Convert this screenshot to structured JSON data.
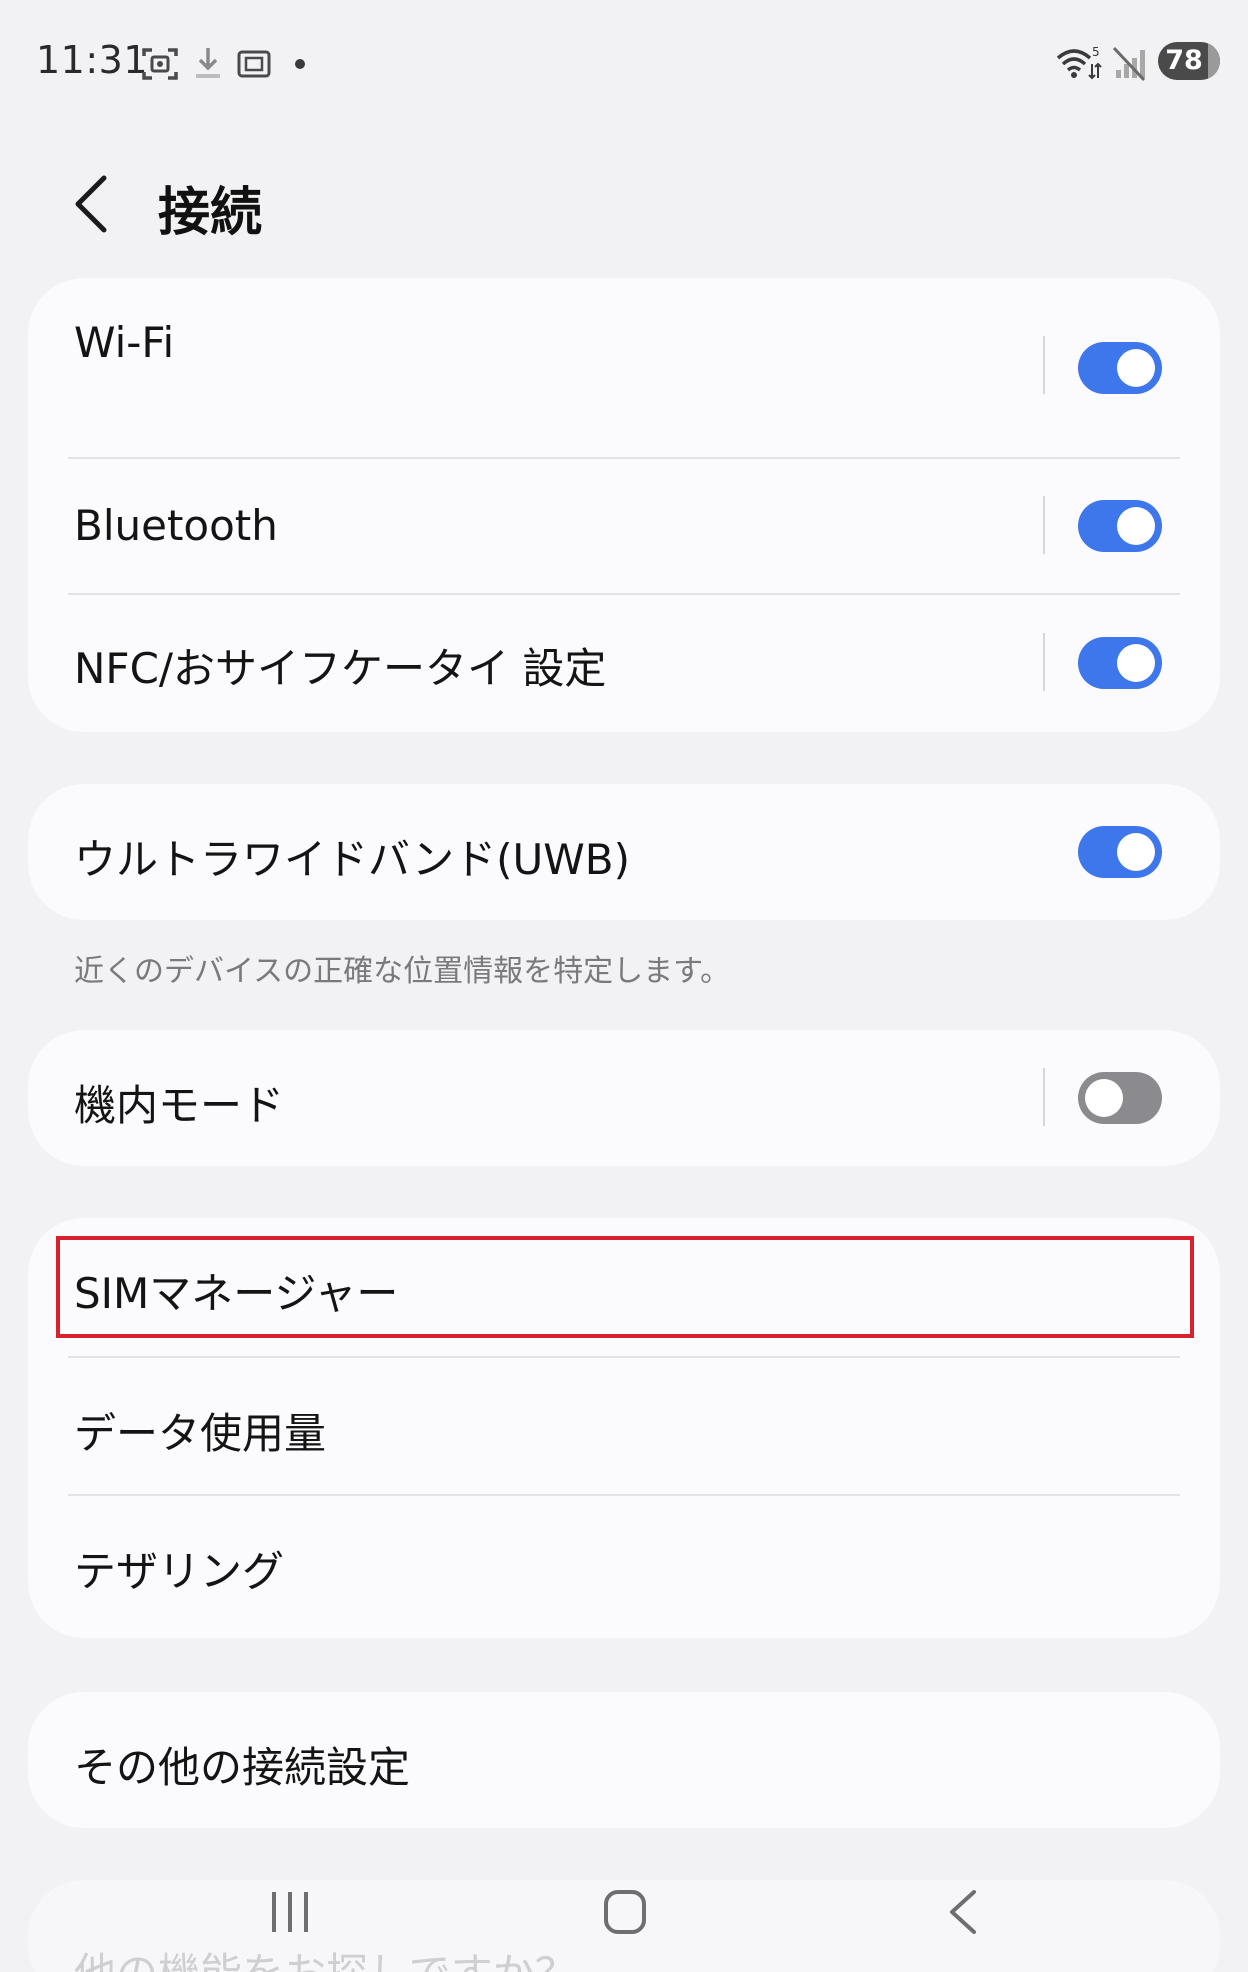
{
  "status_bar": {
    "time": "11:31",
    "battery": "78",
    "icons": [
      "screenshot-icon",
      "download-icon",
      "screen-recorder-icon",
      "notification-dot-icon",
      "wifi-icon",
      "no-signal-icon",
      "battery-icon"
    ]
  },
  "header": {
    "back_icon": "chevron-left-icon",
    "title": "接続"
  },
  "card1": {
    "wifi_label": "Wi-Fi",
    "wifi_on": true,
    "bluetooth_label": "Bluetooth",
    "bluetooth_on": true,
    "nfc_label": "NFC/おサイフケータイ 設定",
    "nfc_on": true
  },
  "card2": {
    "uwb_label": "ウルトラワイドバンド(UWB)",
    "uwb_on": true,
    "uwb_hint": "近くのデバイスの正確な位置情報を特定します。"
  },
  "card3": {
    "airplane_label": "機内モード",
    "airplane_on": false
  },
  "card4": {
    "sim_label": "SIMマネージャー",
    "data_usage_label": "データ使用量",
    "tethering_label": "テザリング"
  },
  "card5": {
    "more_label": "その他の接続設定"
  },
  "peek_text": "他の機能をお探しですか？",
  "colors": {
    "background": "#f2f2f5",
    "card": "#fbfbfd",
    "toggle_on": "#3e76eb",
    "toggle_off": "#8b8b8f",
    "highlight": "#d7222d"
  },
  "navbar": {
    "icons": [
      "recent-apps-icon",
      "home-icon",
      "back-icon"
    ]
  }
}
